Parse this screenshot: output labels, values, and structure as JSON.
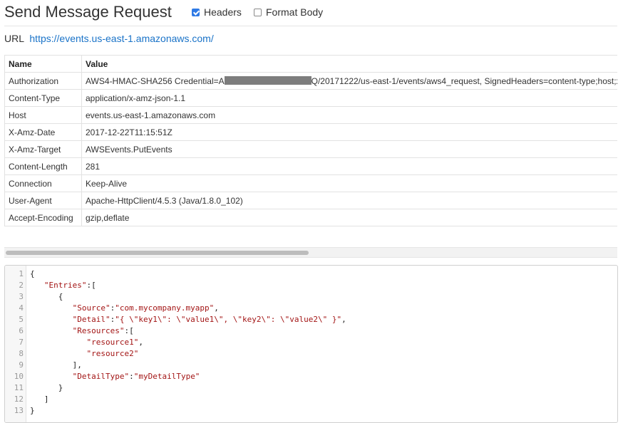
{
  "header": {
    "title": "Send Message Request",
    "headers_label": "Headers",
    "headers_checked": true,
    "format_body_label": "Format Body",
    "format_body_checked": false
  },
  "url": {
    "label": "URL",
    "value": "https://events.us-east-1.amazonaws.com/"
  },
  "headers_table": {
    "columns": [
      "Name",
      "Value"
    ],
    "rows": [
      {
        "name": "Authorization",
        "value_prefix": "AWS4-HMAC-SHA256 Credential=A",
        "value_suffix": "Q/20171222/us-east-1/events/aws4_request, SignedHeaders=content-type;host;x-amz-date;x-amz-target"
      },
      {
        "name": "Content-Type",
        "value": "application/x-amz-json-1.1"
      },
      {
        "name": "Host",
        "value": "events.us-east-1.amazonaws.com"
      },
      {
        "name": "X-Amz-Date",
        "value": "2017-12-22T11:15:51Z"
      },
      {
        "name": "X-Amz-Target",
        "value": "AWSEvents.PutEvents"
      },
      {
        "name": "Content-Length",
        "value": "281"
      },
      {
        "name": "Connection",
        "value": "Keep-Alive"
      },
      {
        "name": "User-Agent",
        "value": "Apache-HttpClient/4.5.3 (Java/1.8.0_102)"
      },
      {
        "name": "Accept-Encoding",
        "value": "gzip,deflate"
      }
    ]
  },
  "body_editor": {
    "lines": [
      {
        "num": "1",
        "text": "{"
      },
      {
        "num": "2",
        "text": "   \"Entries\":["
      },
      {
        "num": "3",
        "text": "      {"
      },
      {
        "num": "4",
        "text": "         \"Source\":\"com.mycompany.myapp\","
      },
      {
        "num": "5",
        "text": "         \"Detail\":\"{ \\\"key1\\\": \\\"value1\\\", \\\"key2\\\": \\\"value2\\\" }\","
      },
      {
        "num": "6",
        "text": "         \"Resources\":["
      },
      {
        "num": "7",
        "text": "            \"resource1\","
      },
      {
        "num": "8",
        "text": "            \"resource2\""
      },
      {
        "num": "9",
        "text": "         ],"
      },
      {
        "num": "10",
        "text": "         \"DetailType\":\"myDetailType\""
      },
      {
        "num": "11",
        "text": "      }"
      },
      {
        "num": "12",
        "text": "   ]"
      },
      {
        "num": "13",
        "text": "}"
      }
    ]
  },
  "colors": {
    "link": "#1a73c8",
    "checkbox_checked": "#2f7ae5",
    "json_string": "#a31515",
    "redaction": "#7d7d7d"
  }
}
